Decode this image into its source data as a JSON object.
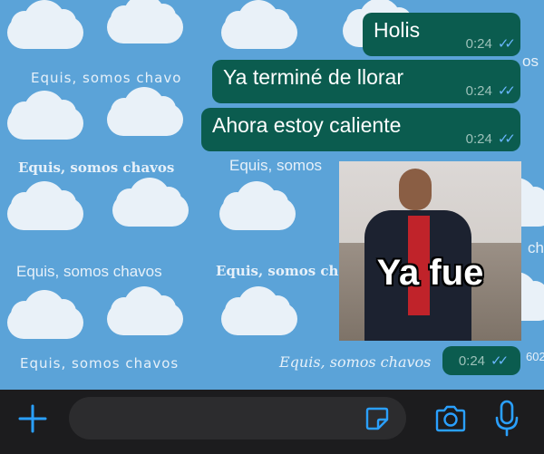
{
  "wallpaper": {
    "phrase": "Equis, somos chavos",
    "partials": [
      "Equis, somos chavo",
      "Equis, somos",
      "Equis, somos chavo",
      "ch",
      "os",
      "602"
    ]
  },
  "messages": [
    {
      "text": "Holis",
      "time": "0:24"
    },
    {
      "text": "Ya terminé de llorar",
      "time": "0:24"
    },
    {
      "text": "Ahora estoy caliente",
      "time": "0:24"
    }
  ],
  "sticker": {
    "caption": "Ya fue",
    "time": "0:24"
  },
  "colors": {
    "bubble": "#0b5c4f",
    "ticks": "#6ab6ff",
    "accent": "#2aa0ff",
    "bar": "#1c1c1e"
  },
  "icons": [
    "plus-icon",
    "sticker-icon",
    "camera-icon",
    "microphone-icon"
  ]
}
